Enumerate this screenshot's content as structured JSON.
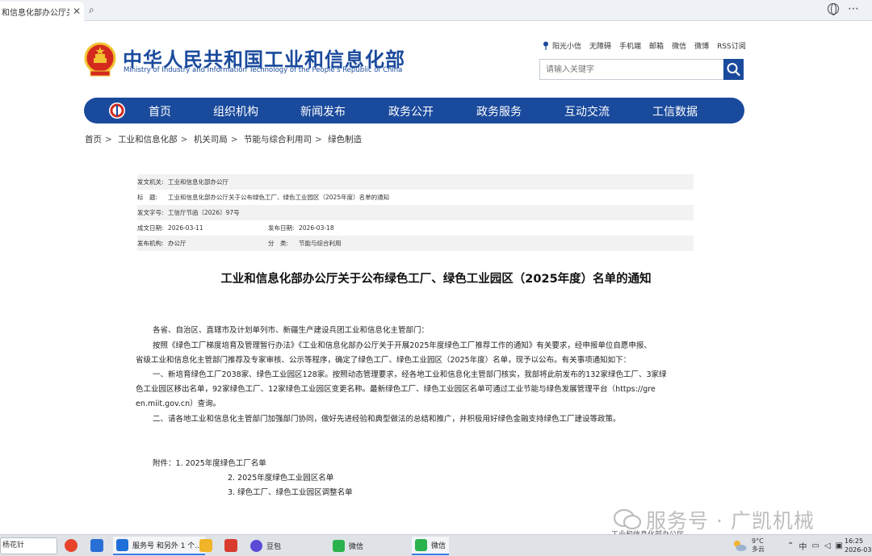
{
  "browser": {
    "tab_title": "和信息化部办公厅关于公",
    "tab_close": "✕",
    "search_glyph": "⌕",
    "more_glyph": "⋯"
  },
  "header": {
    "title": "中华人民共和国工业和信息化部",
    "subtitle": "Ministry of Industry and Information Technology of the People's Republic of China",
    "top_links": [
      "阳光小信",
      "无障碍",
      "手机端",
      "邮箱",
      "微信",
      "微博",
      "RSS订阅"
    ],
    "search_placeholder": "请输入关键字"
  },
  "nav": {
    "items": [
      "首页",
      "组织机构",
      "新闻发布",
      "政务公开",
      "政务服务",
      "互动交流",
      "工信数据"
    ]
  },
  "breadcrumb": [
    "首页",
    "工业和信息化部",
    "机关司局",
    "节能与综合利用司",
    "绿色制造"
  ],
  "info": {
    "issuer_label": "发文机关:",
    "issuer": "工业和信息化部办公厅",
    "title_label": "标　题:",
    "title": "工业和信息化部办公厅关于公布绿色工厂、绿色工业园区（2025年度）名单的通知",
    "docno_label": "发文字号:",
    "docno": "工信厅节函〔2026〕97号",
    "date_label": "成文日期:",
    "date": "2026-03-11",
    "pub_label": "发布日期:",
    "pub": "2026-03-18",
    "org_label": "发布机构:",
    "org": "办公厅",
    "cat_label": "分　类:",
    "cat": "节能与综合利用"
  },
  "document": {
    "heading": "工业和信息化部办公厅关于公布绿色工厂、绿色工业园区（2025年度）名单的通知",
    "salutation": "各省、自治区、直辖市及计划单列市、新疆生产建设兵团工业和信息化主管部门：",
    "para1_l1": "按照《绿色工厂梯度培育及管理暂行办法》《工业和信息化部办公厅关于开展2025年度绿色工厂推荐工作的通知》有关要求，经申报单位自愿申报、",
    "para1_l2": "省级工业和信息化主管部门推荐及专家审核、公示等程序，确定了绿色工厂、绿色工业园区（2025年度）名单，现予以公布。有关事项通知如下：",
    "para2_l1": "一、新培育绿色工厂2038家、绿色工业园区128家。按照动态管理要求，经各地工业和信息化主管部门核实，我部将此前发布的132家绿色工厂、3家绿",
    "para2_l2": "色工业园区移出名单，92家绿色工厂、12家绿色工业园区变更名称。最新绿色工厂、绿色工业园区名单可通过工业节能与绿色发展管理平台（https://gre",
    "para2_l3": "en.miit.gov.cn）查询。",
    "para3": "二、请各地工业和信息化主管部门加强部门协同，做好先进经验和典型做法的总结和推广，并积极用好绿色金融支持绿色工厂建设等政策。",
    "attach1": "附件：1. 2025年度绿色工厂名单",
    "attach2": "2. 2025年度绿色工业园区名单",
    "attach3": "3. 绿色工厂、绿色工业园区调整名单",
    "footer_peek": "工业和信息化部办公厅"
  },
  "watermark": {
    "text": "服务号 · 广凯机械"
  },
  "taskbar": {
    "search_text": "杨花针",
    "apps": [
      {
        "label": "服务号 和另外 1 个...",
        "color": "#1e6fd9"
      },
      {
        "label": "豆包",
        "color": "#5a4bd6"
      },
      {
        "label": "微信",
        "color": "#2bb24c"
      },
      {
        "label": "微信",
        "color": "#2bb24c"
      }
    ],
    "weather_temp": "9°C",
    "weather_desc": "多云",
    "tray_lang": "中",
    "time": "16:25",
    "date": "2026-03"
  },
  "colors": {
    "brand_blue": "#1a4a9c",
    "emblem_red": "#d42a1e",
    "emblem_gold": "#f2c230"
  }
}
